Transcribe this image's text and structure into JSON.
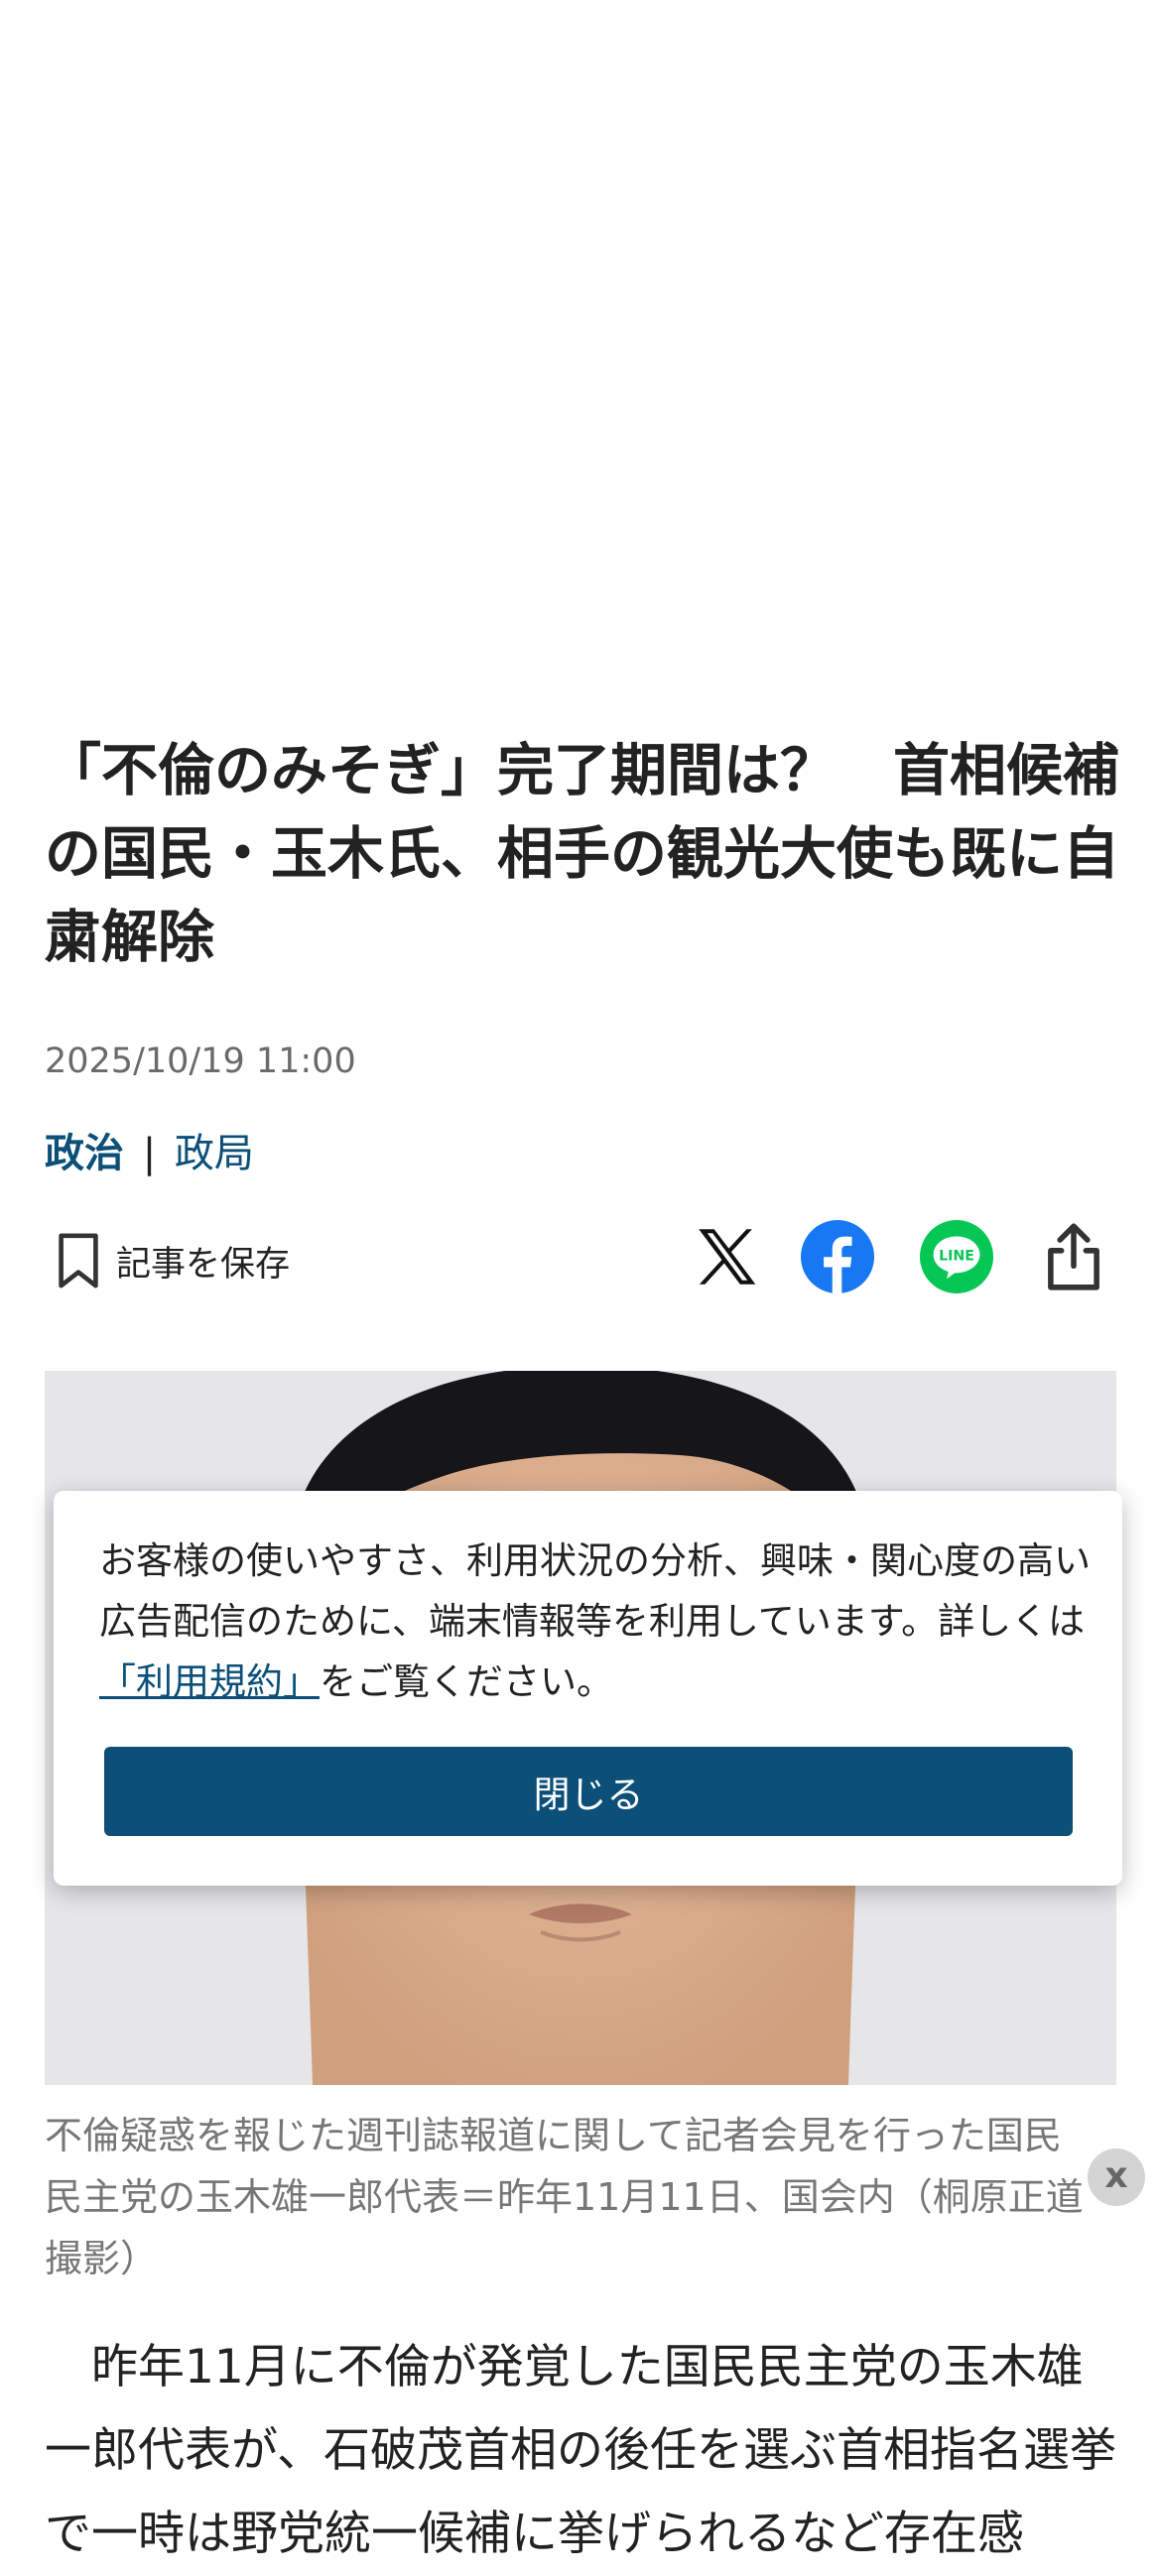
{
  "article": {
    "headline": "「不倫のみそぎ」完了期間は？　首相候補の国民・玉木氏、相手の観光大使も既に自粛解除",
    "date": "2025/10/19 11:00",
    "category": "政治",
    "separator": "|",
    "subcategory": "政局",
    "save_label": "記事を保存",
    "photo_caption": "不倫疑惑を報じた週刊誌報道に関して記者会見を行った国民民主党の玉木雄一郎代表＝昨年11月11日、国会内（桐原正道撮影）",
    "body": "　昨年11月に不倫が発覚した国民民主党の玉木雄一郎代表が、石破茂首相の後任を選ぶ首相指名選挙で一時は野党統一候補に挙げられるなど存在感"
  },
  "share_icons": [
    "x-icon",
    "facebook-icon",
    "line-icon",
    "share-icon"
  ],
  "consent": {
    "text_before": "お客様の使いやすさ、利用状況の分析、興味・関心度の高い広告配信のために、端末情報等を利用しています。詳しくは",
    "link_text": "「利用規約」",
    "text_after": "をご覧ください。",
    "close_label": "閉じる"
  },
  "dismiss_label": "x",
  "colors": {
    "accent": "#0c4f78",
    "facebook": "#1877f2",
    "line": "#06c755",
    "caption": "#777777"
  }
}
